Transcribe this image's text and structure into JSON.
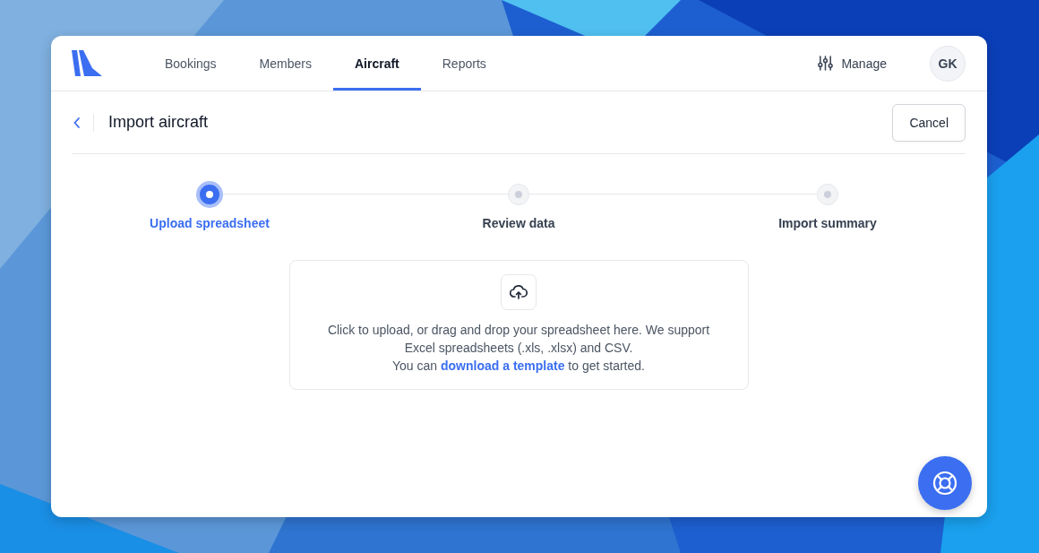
{
  "nav": {
    "tabs": [
      {
        "label": "Bookings",
        "selected": false
      },
      {
        "label": "Members",
        "selected": false
      },
      {
        "label": "Aircraft",
        "selected": true
      },
      {
        "label": "Reports",
        "selected": false
      }
    ],
    "manage": "Manage",
    "avatar": "GK"
  },
  "header": {
    "title": "Import aircraft",
    "cancel": "Cancel"
  },
  "steps": [
    {
      "label": "Upload spreadsheet",
      "selected": true
    },
    {
      "label": "Review data",
      "selected": false
    },
    {
      "label": "Import summary",
      "selected": false
    }
  ],
  "upload": {
    "description": "Click to upload, or drag and drop your spreadsheet here. We support Excel spreadsheets (.xls, .xlsx) and CSV.",
    "before": "You can ",
    "link": "download a template",
    "after": " to get started."
  }
}
